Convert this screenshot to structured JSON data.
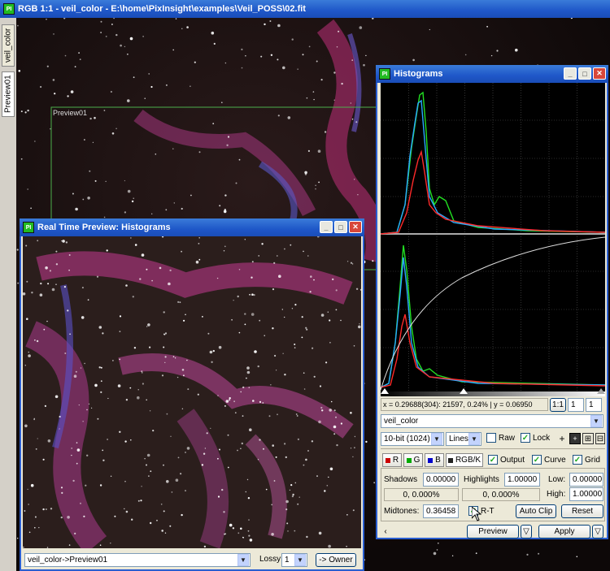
{
  "main_window": {
    "title": "RGB 1:1 - veil_color - E:\\home\\PixInsight\\examples\\Veil_POSS\\02.fit",
    "side_tabs": [
      "veil_color",
      "Preview01"
    ],
    "preview_label": "Preview01"
  },
  "histograms": {
    "title": "Histograms",
    "readout": "x = 0.29688(304): 21597, 0.24% | y = 0.06950",
    "zoom_label": "1:1",
    "zoom_h": "1",
    "zoom_v": "1",
    "view": "veil_color",
    "resolution": "10-bit (1024)",
    "graph_style": "Lines",
    "raw_label": "Raw",
    "lock_label": "Lock",
    "channels": [
      "R",
      "G",
      "B",
      "RGB/K"
    ],
    "output_label": "Output",
    "curve_label": "Curve",
    "grid_label": "Grid",
    "shadows_label": "Shadows",
    "shadows_value": "0.00000",
    "shadows_clip": "0, 0.000%",
    "highlights_label": "Highlights",
    "highlights_value": "1.00000",
    "highlights_clip": "0, 0.000%",
    "low_label": "Low:",
    "low_value": "0.00000",
    "high_label": "High:",
    "high_value": "1.00000",
    "midtones_label": "Midtones:",
    "midtones_value": "0.36458",
    "rt_label": "R-T",
    "autoclip_label": "Auto Clip",
    "reset_label": "Reset",
    "preview_label": "Preview",
    "apply_label": "Apply",
    "colors": {
      "red": "#ff2a2a",
      "green": "#22e022",
      "blue": "#2aa8ff"
    }
  },
  "rtp": {
    "title": "Real Time Preview: Histograms",
    "view_select": "veil_color->Preview01",
    "lossy_label": "Lossy:",
    "lossy_value": "1",
    "owner_label": "-> Owner"
  }
}
